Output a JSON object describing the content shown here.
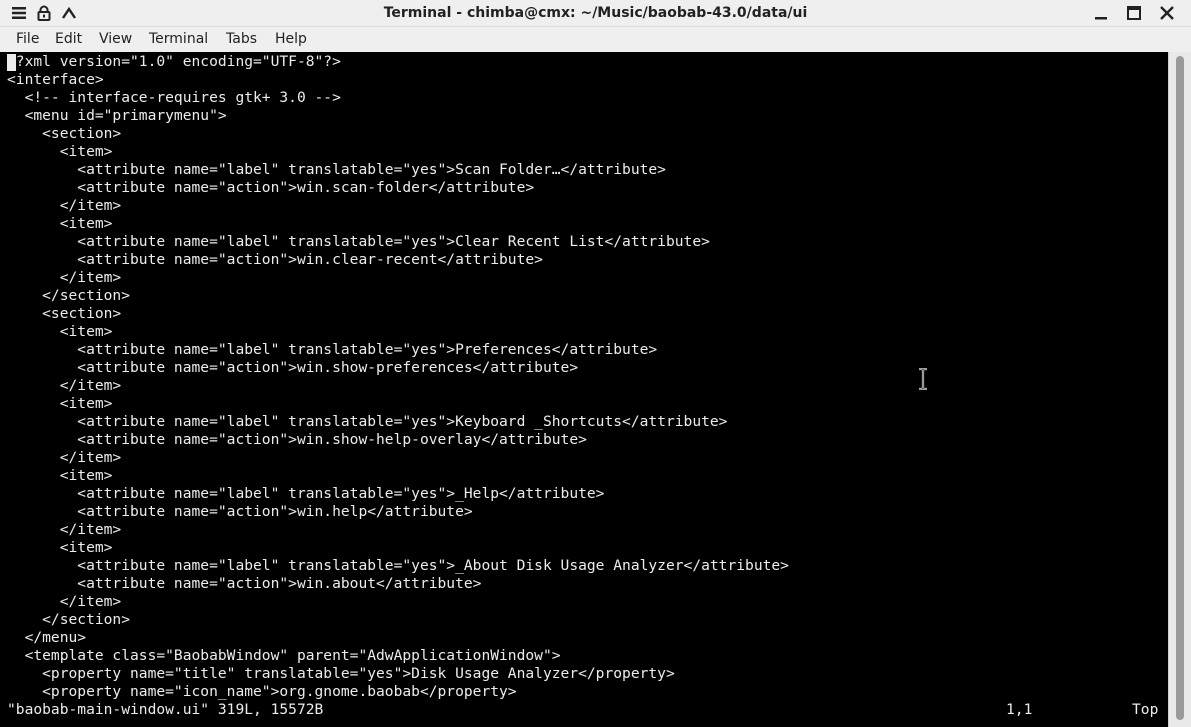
{
  "window": {
    "title": "Terminal - chimba@cmx: ~/Music/baobab-43.0/data/ui",
    "left_icons": [
      "menu-icon",
      "lock-icon",
      "chevron-up-icon"
    ],
    "right_icons": [
      "minimize-icon",
      "maximize-icon",
      "close-icon"
    ]
  },
  "menubar": {
    "items": [
      "File",
      "Edit",
      "View",
      "Terminal",
      "Tabs",
      "Help"
    ]
  },
  "terminal": {
    "lines": [
      "<?xml version=\"1.0\" encoding=\"UTF-8\"?>",
      "<interface>",
      "  <!-- interface-requires gtk+ 3.0 -->",
      "  <menu id=\"primarymenu\">",
      "    <section>",
      "      <item>",
      "        <attribute name=\"label\" translatable=\"yes\">Scan Folder…</attribute>",
      "        <attribute name=\"action\">win.scan-folder</attribute>",
      "      </item>",
      "      <item>",
      "        <attribute name=\"label\" translatable=\"yes\">Clear Recent List</attribute>",
      "        <attribute name=\"action\">win.clear-recent</attribute>",
      "      </item>",
      "    </section>",
      "    <section>",
      "      <item>",
      "        <attribute name=\"label\" translatable=\"yes\">Preferences</attribute>",
      "        <attribute name=\"action\">win.show-preferences</attribute>",
      "      </item>",
      "      <item>",
      "        <attribute name=\"label\" translatable=\"yes\">Keyboard _Shortcuts</attribute>",
      "        <attribute name=\"action\">win.show-help-overlay</attribute>",
      "      </item>",
      "      <item>",
      "        <attribute name=\"label\" translatable=\"yes\">_Help</attribute>",
      "        <attribute name=\"action\">win.help</attribute>",
      "      </item>",
      "      <item>",
      "        <attribute name=\"label\" translatable=\"yes\">_About Disk Usage Analyzer</attribute>",
      "        <attribute name=\"action\">win.about</attribute>",
      "      </item>",
      "    </section>",
      "  </menu>",
      "  <template class=\"BaobabWindow\" parent=\"AdwApplicationWindow\">",
      "    <property name=\"title\" translatable=\"yes\">Disk Usage Analyzer</property>",
      "    <property name=\"icon_name\">org.gnome.baobab</property>"
    ],
    "status": {
      "file": "\"baobab-main-window.ui\" 319L, 15572B",
      "position": "1,1",
      "scroll": "Top"
    }
  }
}
